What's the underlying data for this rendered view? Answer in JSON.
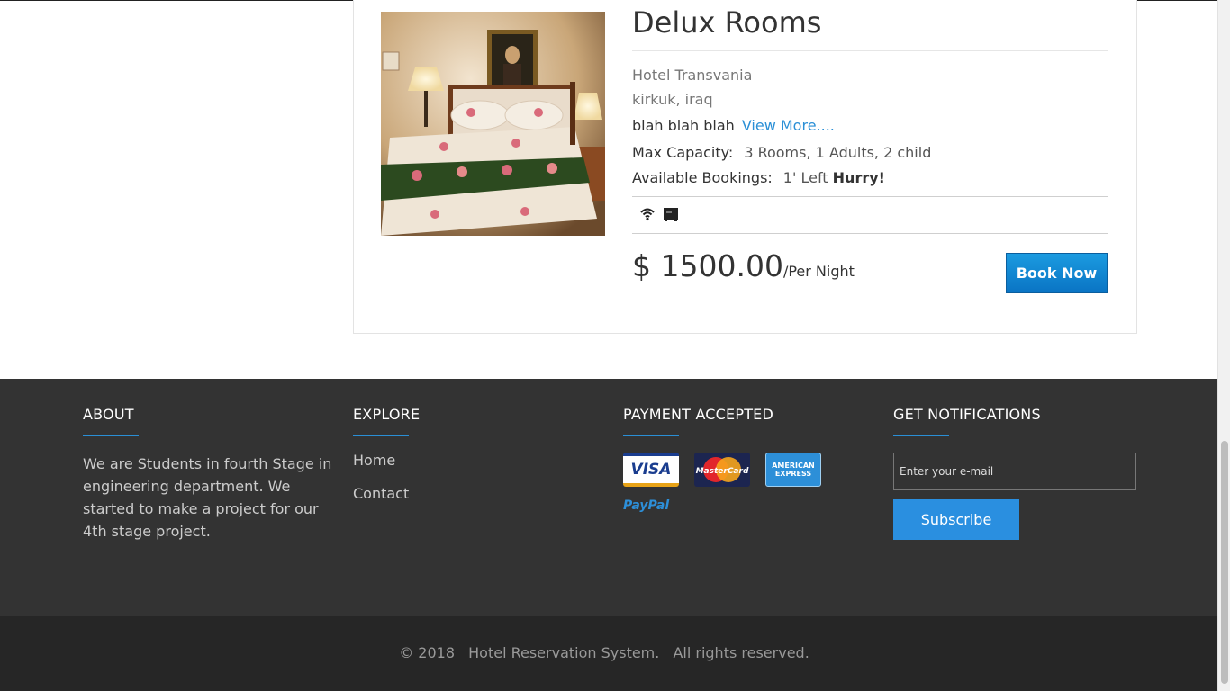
{
  "room": {
    "title": "Delux Rooms",
    "hotel_name": "Hotel Transvania",
    "location": "kirkuk, iraq",
    "description": "blah blah blah",
    "view_more": "View More....",
    "capacity_label": "Max Capacity:",
    "capacity_value": "3 Rooms, 1 Adults, 2 child",
    "bookings_label": "Available Bookings:",
    "bookings_value": "1' Left",
    "bookings_urgency": "Hurry!",
    "amenities": [
      "wifi-icon",
      "tv-icon"
    ],
    "price": "$ 1500.00",
    "price_unit": "/Per Night",
    "book_button": "Book Now"
  },
  "footer": {
    "about": {
      "title": "ABOUT",
      "text": "We are Students in fourth Stage in engineering department. We started to make a project for our 4th stage project."
    },
    "explore": {
      "title": "EXPLORE",
      "links": [
        "Home",
        "Contact"
      ]
    },
    "payment": {
      "title": "PAYMENT ACCEPTED",
      "cards": [
        "VISA",
        "MasterCard",
        "AMERICAN EXPRESS",
        "PayPal"
      ]
    },
    "notifications": {
      "title": "GET NOTIFICATIONS",
      "email_placeholder": "Enter your e-mail",
      "subscribe_button": "Subscribe"
    },
    "copyright": {
      "year": "© 2018",
      "name": "Hotel Reservation System.",
      "rights": "All rights reserved."
    }
  },
  "colors": {
    "accent": "#2a8fd6",
    "footer_bg": "#333333",
    "bottom_bar_bg": "#262626",
    "book_button": "#0a74c4"
  }
}
